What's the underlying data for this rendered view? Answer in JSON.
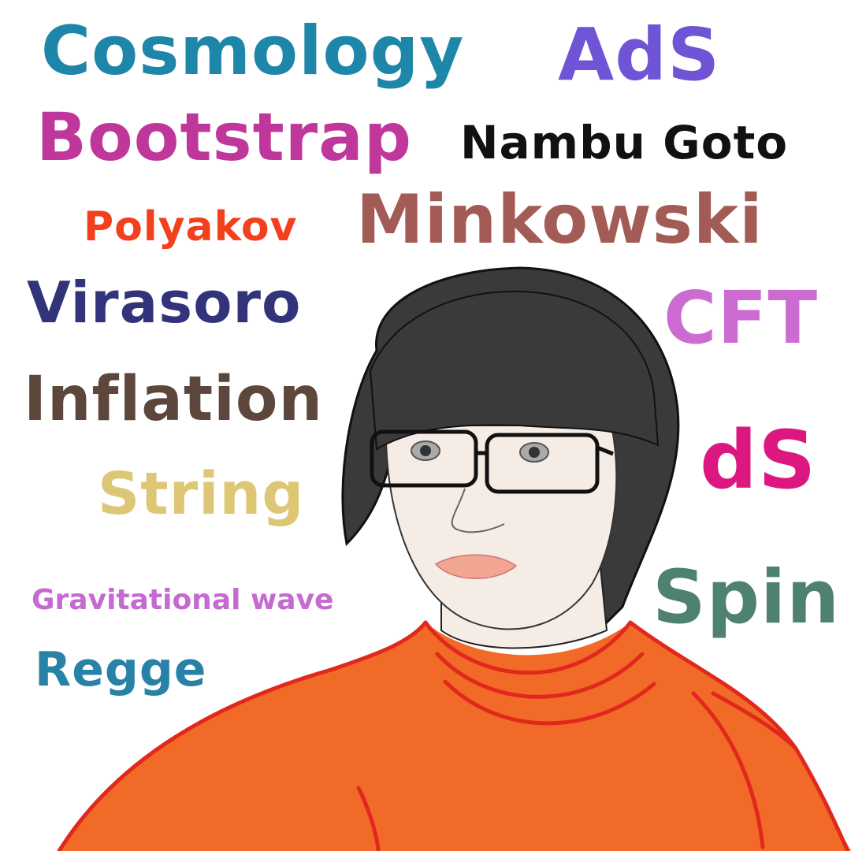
{
  "words": {
    "cosmology": "Cosmology",
    "ads": "AdS",
    "bootstrap": "Bootstrap",
    "nambu_goto": "Nambu Goto",
    "polyakov": "Polyakov",
    "minkowski": "Minkowski",
    "virasoro": "Virasoro",
    "cft": "CFT",
    "inflation": "Inflation",
    "ds": "dS",
    "string": "String",
    "gravitational_wave": "Gravitational wave",
    "spin": "Spin",
    "regge": "Regge"
  },
  "colors": {
    "background": "#ffffff",
    "cosmology": "#1e86a8",
    "ads": "#6f55d6",
    "bootstrap": "#c0379c",
    "nambu_goto": "#111111",
    "polyakov": "#f2401d",
    "minkowski": "#a25c55",
    "virasoro": "#32337a",
    "cft": "#cc6cd2",
    "inflation": "#5d463c",
    "ds": "#dd1780",
    "string": "#ddc774",
    "gravitational_wave": "#c46ad0",
    "spin": "#4e8172",
    "regge": "#2782a6",
    "hair": "#3a3a3a",
    "skin": "#f6ece6",
    "sweater": "#f26a28",
    "sweater_line": "#e1281c",
    "lips": "#f2a58f",
    "glasses": "#111111"
  },
  "illustration": "portrait-drawing"
}
